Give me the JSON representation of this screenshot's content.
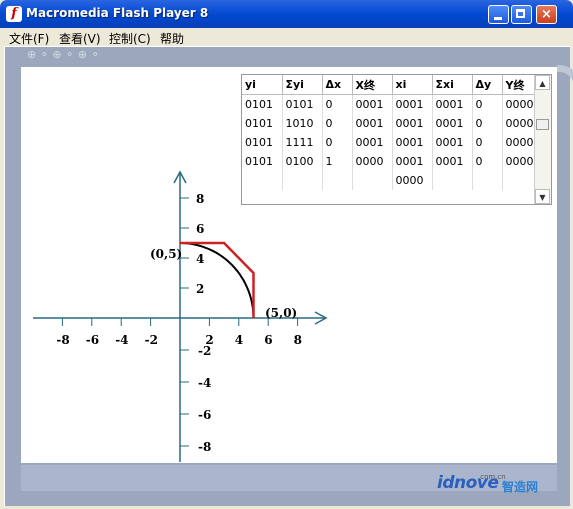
{
  "window": {
    "title": "Macromedia Flash Player 8",
    "icon": "flash-icon",
    "buttons": {
      "minimize": "minimize",
      "maximize": "maximize",
      "close": "×"
    }
  },
  "menu": [
    "文件(F)",
    "查看(V)",
    "控制(C)",
    "帮助"
  ],
  "table": {
    "headers": [
      "yi",
      "Σyi",
      "Δx",
      "X终",
      "xi",
      "Σxi",
      "Δy",
      "Y终"
    ],
    "rows": [
      [
        "0101",
        "0101",
        "0",
        "0001",
        "0001",
        "0001",
        "0",
        "0000"
      ],
      [
        "0101",
        "1010",
        "0",
        "0001",
        "0001",
        "0001",
        "0",
        "0000"
      ],
      [
        "0101",
        "1111",
        "0",
        "0001",
        "0001",
        "0001",
        "0",
        "0000"
      ],
      [
        "0101",
        "0100",
        "1",
        "0000",
        "0001",
        "0001",
        "0",
        "0000"
      ],
      [
        "",
        "",
        "",
        "",
        "0000",
        "",
        "",
        ""
      ]
    ]
  },
  "graph": {
    "x_ticks": [
      "-8",
      "-6",
      "-4",
      "-2",
      "2",
      "4",
      "6",
      "8"
    ],
    "y_ticks_pos": [
      "8",
      "6",
      "4",
      "2"
    ],
    "y_ticks_neg": [
      "-2",
      "-4",
      "-6",
      "-8"
    ],
    "label_start": "(0,5)",
    "label_end": "(5,0)",
    "colors": {
      "axis": "#2a6b80",
      "arc": "#000000",
      "approx": "#cc2222"
    }
  },
  "watermark": {
    "brand": "idnove",
    "suffix": "智造网",
    "domain": ".com.cn"
  }
}
